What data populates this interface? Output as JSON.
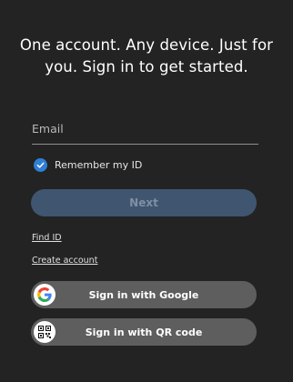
{
  "headline": "One account. Any device. Just for you. Sign in to get started.",
  "email": {
    "placeholder": "Email",
    "value": ""
  },
  "remember": {
    "label": "Remember my ID",
    "checked": true
  },
  "next_label": "Next",
  "links": {
    "find_id": "Find ID",
    "create_account": "Create account"
  },
  "social": {
    "google_label": "Sign in with Google",
    "qr_label": "Sign in with QR code"
  },
  "colors": {
    "background": "#232323",
    "checkbox": "#2f7fd6",
    "next_disabled": "#3f5570",
    "social_button": "#5e5e5e"
  },
  "icons": {
    "checkbox": "check-icon",
    "google": "google-logo-icon",
    "qr": "qr-code-icon"
  }
}
